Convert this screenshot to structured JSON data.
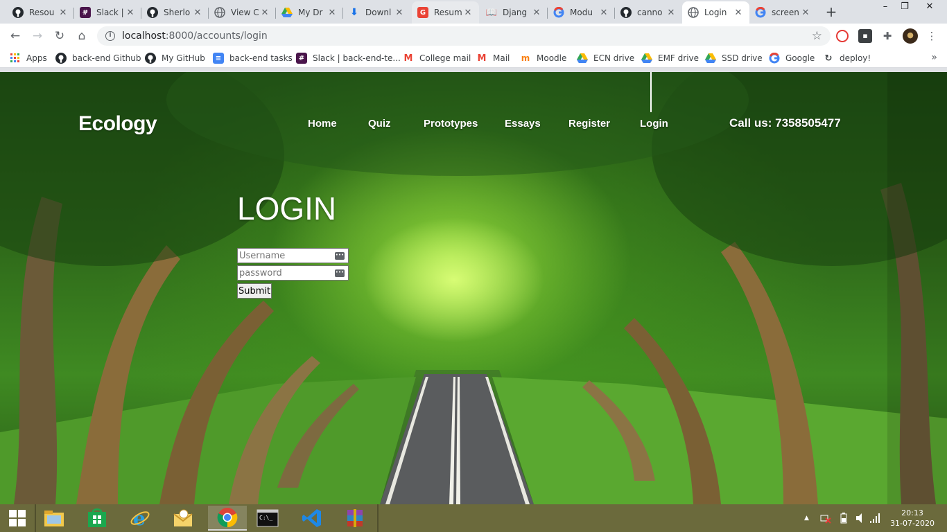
{
  "browser": {
    "tabs": [
      {
        "title": "Resou",
        "icon": "github-icon",
        "active": false
      },
      {
        "title": "Slack |",
        "icon": "slack-icon",
        "active": false
      },
      {
        "title": "Sherlo",
        "icon": "github-icon",
        "active": false
      },
      {
        "title": "View C",
        "icon": "globe-icon",
        "active": false
      },
      {
        "title": "My Dr",
        "icon": "google-drive-icon",
        "active": false
      },
      {
        "title": "Downl",
        "icon": "download-icon",
        "active": false
      },
      {
        "title": "Resum",
        "icon": "google-icon",
        "active": false
      },
      {
        "title": "Djang",
        "icon": "book-icon",
        "active": false
      },
      {
        "title": "Modu",
        "icon": "google-icon",
        "active": false
      },
      {
        "title": "canno",
        "icon": "github-icon",
        "active": false
      },
      {
        "title": "Login",
        "icon": "globe-icon",
        "active": true
      },
      {
        "title": "screen",
        "icon": "google-icon",
        "active": false
      }
    ],
    "new_tab_label": "+",
    "window": {
      "minimize": "–",
      "restore": "❐",
      "close": "✕"
    },
    "url_host": "localhost",
    "url_path": ":8000/accounts/login",
    "bookmarks": [
      {
        "label": "Apps",
        "icon": "apps-grid-icon"
      },
      {
        "label": "back-end Github",
        "icon": "github-icon"
      },
      {
        "label": "My GitHub",
        "icon": "github-icon"
      },
      {
        "label": "back-end tasks",
        "icon": "google-docs-icon"
      },
      {
        "label": "Slack | back-end-te...",
        "icon": "slack-icon"
      },
      {
        "label": "College mail",
        "icon": "gmail-icon"
      },
      {
        "label": "Mail",
        "icon": "gmail-icon"
      },
      {
        "label": "Moodle",
        "icon": "moodle-icon"
      },
      {
        "label": "ECN drive",
        "icon": "google-drive-icon"
      },
      {
        "label": "EMF drive",
        "icon": "google-drive-icon"
      },
      {
        "label": "SSD drive",
        "icon": "google-drive-icon"
      },
      {
        "label": "Google",
        "icon": "google-icon"
      },
      {
        "label": "deploy!",
        "icon": "deploy-icon"
      }
    ],
    "bookmarks_more": "»"
  },
  "site": {
    "brand": "Ecology",
    "nav": [
      "Home",
      "Quiz",
      "Prototypes",
      "Essays",
      "Register",
      "Login"
    ],
    "call_us": "Call us: 7358505477",
    "heading": "LOGIN",
    "username_placeholder": "Username",
    "password_placeholder": "password",
    "submit_label": "Submit"
  },
  "taskbar": {
    "apps": [
      {
        "name": "file-explorer-icon",
        "active": false
      },
      {
        "name": "windows-store-icon",
        "active": false
      },
      {
        "name": "internet-explorer-icon",
        "active": false
      },
      {
        "name": "outlook-icon",
        "active": false
      },
      {
        "name": "chrome-icon",
        "active": true
      },
      {
        "name": "command-prompt-icon",
        "active": false
      },
      {
        "name": "vscode-icon",
        "active": false
      },
      {
        "name": "winrar-icon",
        "active": false
      }
    ],
    "time": "20:13",
    "date": "31-07-2020"
  },
  "colors": {
    "tabstrip": "#dee1e6",
    "taskbar": "#6b6a3c",
    "foliage": "#3f8a22"
  }
}
